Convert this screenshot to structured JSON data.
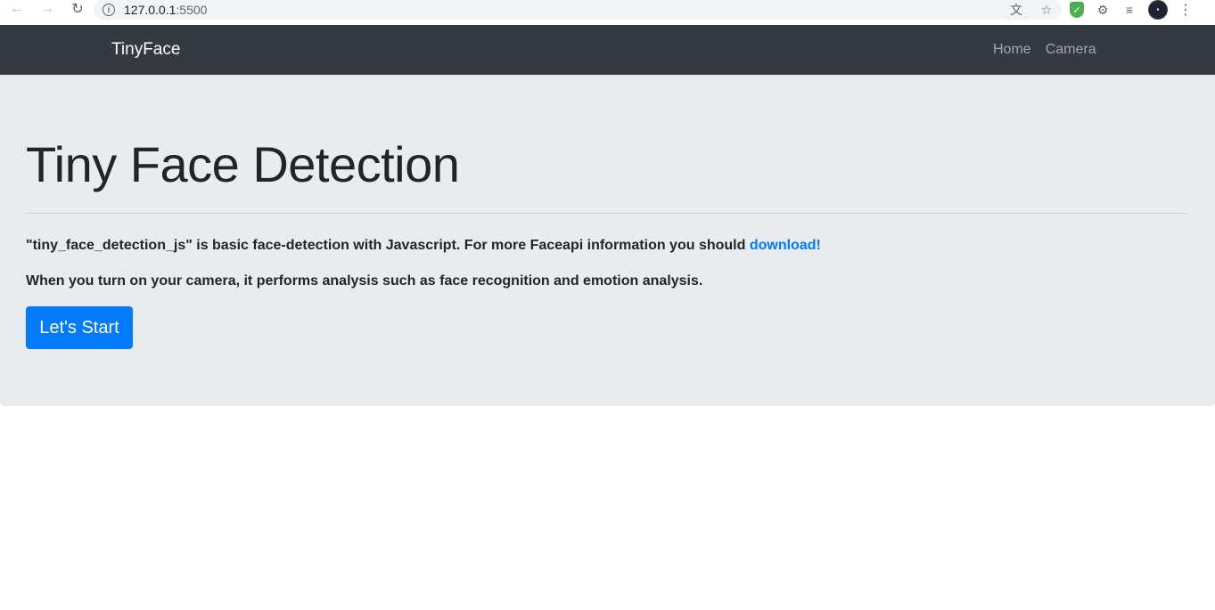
{
  "browser": {
    "url_host": "127.0.0.1",
    "url_port": ":5500",
    "icons": [
      "back-icon",
      "forward-icon",
      "reload-icon",
      "info-icon",
      "translate-icon",
      "star-icon",
      "shield-extension-icon",
      "puzzle-icon",
      "reading-list-icon",
      "profile-avatar",
      "menu-icon"
    ]
  },
  "navbar": {
    "brand": "TinyFace",
    "links": [
      "Home",
      "Camera"
    ]
  },
  "jumbotron": {
    "title": "Tiny Face Detection",
    "lead_text": "\"tiny_face_detection_js\" is basic face-detection with Javascript. For more Faceapi information you should ",
    "lead_link": "download!",
    "second_text": "When you turn on your camera, it performs analysis such as face recognition and emotion analysis.",
    "button_label": "Let's Start"
  },
  "colors": {
    "navbar_bg": "#343a40",
    "jumbotron_bg": "#e9ecef",
    "primary": "#007bff"
  }
}
